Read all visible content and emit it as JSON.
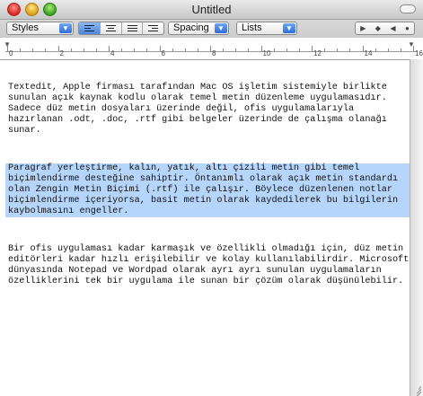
{
  "window": {
    "title": "Untitled"
  },
  "toolbar": {
    "styles_label": "Styles",
    "spacing_label": "Spacing",
    "lists_label": "Lists",
    "align_options": [
      "align-left",
      "align-center",
      "align-justify",
      "align-right"
    ],
    "active_align": "align-left"
  },
  "ruler": {
    "numbers": [
      "0",
      "2",
      "4",
      "6",
      "8",
      "10",
      "12",
      "14",
      "16"
    ]
  },
  "document": {
    "paragraphs": [
      "Textedit, Apple firması tarafından Mac OS işletim sistemiyle birlikte sunulan açık kaynak kodlu olarak temel metin düzenleme uygulamasıdır. Sadece düz metin dosyaları üzerinde değil, ofis uygulamalarıyla hazırlanan .odt, .doc, .rtf gibi belgeler üzerinde de çalışma olanağı sunar.",
      "Paragraf yerleştirme, kalın, yatık, altı çizili metin gibi temel biçimlendirme desteğine sahiptir. Öntanımlı olarak açık metin standardı olan Zengin Metin Biçimi (.rtf) ile çalışır. Böylece düzenlenen notlar biçimlendirme içeriyorsa, basit metin olarak kaydedilerek bu bilgilerin kaybolmasını engeller.",
      "Bir ofis uygulaması kadar karmaşık ve özellikli olmadığı için, düz metin editörleri kadar hızlı erişilebilir ve kolay kullanılabilirdir. Microsoft dünyasında Notepad ve Wordpad olarak ayrı ayrı sunulan uygulamaların özelliklerini tek bir uygulama ile sunan bir çözüm olarak düşünülebilir."
    ],
    "selected_paragraph": 2
  }
}
